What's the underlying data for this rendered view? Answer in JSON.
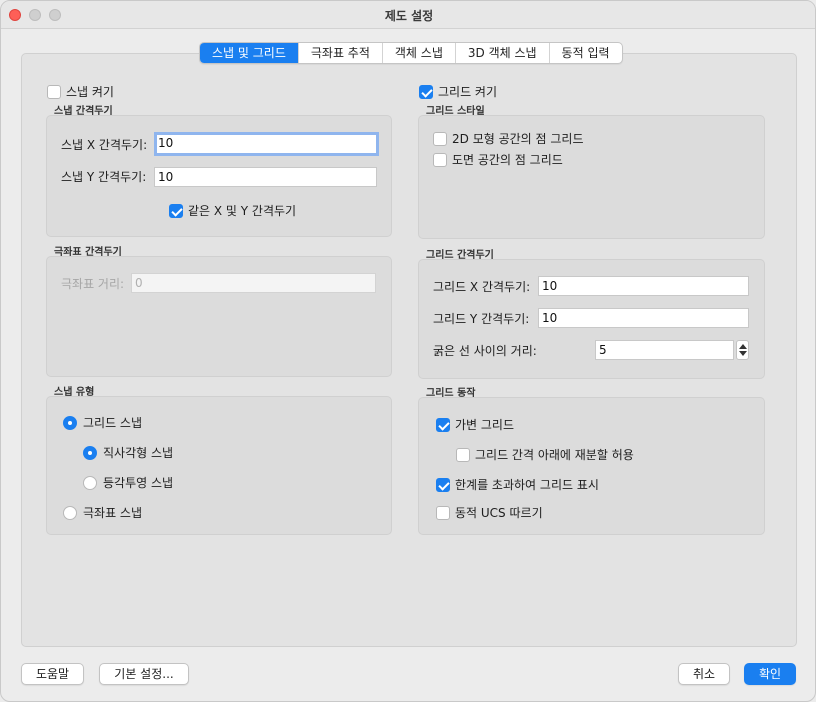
{
  "window": {
    "title": "제도 설정"
  },
  "tabs": [
    {
      "label": "스냅 및 그리드",
      "active": true
    },
    {
      "label": "극좌표 추적",
      "active": false
    },
    {
      "label": "객체 스냅",
      "active": false
    },
    {
      "label": "3D 객체 스냅",
      "active": false
    },
    {
      "label": "동적 입력",
      "active": false
    }
  ],
  "snap": {
    "enable_label": "스냅 켜기",
    "enabled": false,
    "spacing_group": "스냅 간격두기",
    "x_label": "스냅 X 간격두기:",
    "x_value": "10",
    "y_label": "스냅 Y 간격두기:",
    "y_value": "10",
    "equal_label": "같은 X 및 Y 간격두기",
    "equal_checked": true
  },
  "polar": {
    "group": "극좌표 간격두기",
    "distance_label": "극좌표 거리:",
    "distance_value": "0"
  },
  "snap_type": {
    "group": "스냅 유형",
    "grid_snap": "그리드 스냅",
    "rectangular": "직사각형 스냅",
    "isometric": "등각투영 스냅",
    "polar_snap": "극좌표 스냅"
  },
  "grid": {
    "enable_label": "그리드 켜기",
    "enabled": true,
    "style_group": "그리드 스타일",
    "dot_2d": "2D 모형 공간의 점 그리드",
    "dot_sheet": "도면 공간의 점 그리드",
    "spacing_group": "그리드 간격두기",
    "x_label": "그리드 X 간격두기:",
    "x_value": "10",
    "y_label": "그리드 Y 간격두기:",
    "y_value": "10",
    "major_label": "굵은 선 사이의 거리:",
    "major_value": "5",
    "behavior_group": "그리드 동작",
    "adaptive": "가변 그리드",
    "subdivide": "그리드 간격 아래에 재분할 허용",
    "beyond_limits": "한계를 초과하여 그리드 표시",
    "follow_ucs": "동적 UCS 따르기"
  },
  "footer": {
    "help": "도움말",
    "defaults": "기본 설정...",
    "cancel": "취소",
    "ok": "확인"
  },
  "colors": {
    "accent": "#1a7ff0",
    "close": "#fe5f57"
  }
}
